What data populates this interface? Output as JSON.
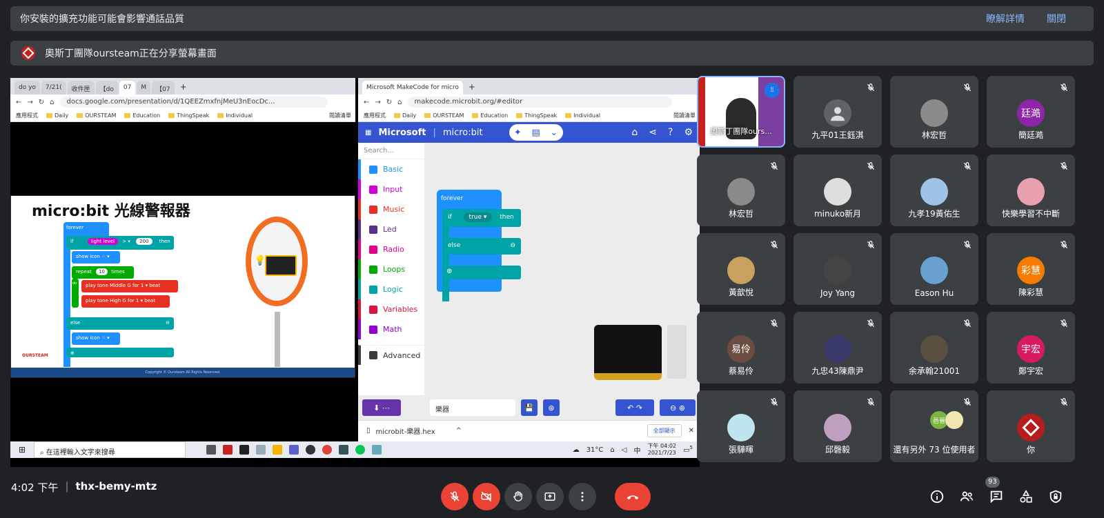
{
  "notice": {
    "text": "你安裝的擴充功能可能會影響通話品質",
    "learn_more": "瞭解詳情",
    "close": "關閉"
  },
  "share_banner": {
    "text": "奧斯丁團隊oursteam正在分享螢幕畫面"
  },
  "left_browser": {
    "tabs": [
      "do yo",
      "7/21(",
      "收件匣",
      "【do",
      "07",
      "M",
      "【07"
    ],
    "url": "docs.google.com/presentation/d/1QEEZmxfnjMeU3nEocDc...",
    "bookmarks": [
      "應用程式",
      "Daily",
      "OURSTEAM",
      "Education",
      "ThingSpeak",
      "Individual"
    ],
    "reading_list": "閱讀清單",
    "slide_title": "micro:bit 光線警報器",
    "slide_blocks": {
      "forever": "forever",
      "if": "if",
      "light_level": "light level",
      "gt": "> ▾",
      "num": "200",
      "then": "then",
      "show_icon": "show icon",
      "repeat": "repeat",
      "times_n": "10",
      "times": "times",
      "do": "do",
      "tone1": "play tone  Middle G  for  1 ▾ beat",
      "tone2": "play tone  High G  for  1 ▾ beat",
      "else": "else",
      "show_icon2": "show icon"
    },
    "slide_logo": "OURSTEAM",
    "slide_footer": "Copyright © Oursteam All Rights Reserved."
  },
  "right_browser": {
    "tab": "Microsoft MakeCode for micro",
    "url": "makecode.microbit.org/#editor",
    "bookmarks": [
      "應用程式",
      "Daily",
      "OURSTEAM",
      "Education",
      "ThingSpeak",
      "Individual"
    ],
    "reading_list": "閱讀清單",
    "brand": "Microsoft",
    "product": "micro:bit",
    "search_placeholder": "Search...",
    "categories": [
      {
        "label": "Basic",
        "color": "#1e90ff"
      },
      {
        "label": "Input",
        "color": "#d400d4"
      },
      {
        "label": "Music",
        "color": "#e63022"
      },
      {
        "label": "Led",
        "color": "#5c2d91"
      },
      {
        "label": "Radio",
        "color": "#e3008c"
      },
      {
        "label": "Loops",
        "color": "#00aa00"
      },
      {
        "label": "Logic",
        "color": "#00a4a6"
      },
      {
        "label": "Variables",
        "color": "#dc143c"
      },
      {
        "label": "Math",
        "color": "#9400d3"
      },
      {
        "label": "Advanced",
        "color": "#3c3c3c"
      }
    ],
    "blocks": {
      "forever": "forever",
      "if": "if",
      "cond": "true ▾",
      "then": "then",
      "else": "else"
    },
    "project_name": "樂器",
    "download_file": "microbit-樂器.hex",
    "show_all": "全部顯示"
  },
  "taskbar": {
    "search": "在這裡輸入文字來搜尋",
    "temp": "31°C",
    "ime": "中",
    "time": "下午 04:02",
    "date": "2021/7/23",
    "notif": "5"
  },
  "tiles": [
    {
      "name": "奧斯丁團隊ours...",
      "avatar": "",
      "avatar_color": "#ffffff",
      "presenter": true
    },
    {
      "name": "九平01王鈺淇",
      "avatar": "",
      "avatar_color": "#5f6368"
    },
    {
      "name": "林宏哲",
      "avatar": "",
      "avatar_color": "#8a8a8a"
    },
    {
      "name": "簡廷澔",
      "avatar": "廷澔",
      "avatar_color": "#8e24aa"
    },
    {
      "name": "林宏哲",
      "avatar": "",
      "avatar_color": "#8a8a8a"
    },
    {
      "name": "minuko新月",
      "avatar": "",
      "avatar_color": "#dddddd"
    },
    {
      "name": "九孝19黃佑生",
      "avatar": "",
      "avatar_color": "#9ec3e6"
    },
    {
      "name": "快樂學習不中斷",
      "avatar": "",
      "avatar_color": "#e8a0b0"
    },
    {
      "name": "黃歆悅",
      "avatar": "",
      "avatar_color": "#c8a060"
    },
    {
      "name": "Joy Yang",
      "avatar": "",
      "avatar_color": "#444444"
    },
    {
      "name": "Eason Hu",
      "avatar": "",
      "avatar_color": "#6aa0d0"
    },
    {
      "name": "陳彩慧",
      "avatar": "彩慧",
      "avatar_color": "#f57c00"
    },
    {
      "name": "蔡易伶",
      "avatar": "易伶",
      "avatar_color": "#6d4c41"
    },
    {
      "name": "九忠43陳鼎尹",
      "avatar": "",
      "avatar_color": "#3a3a6a"
    },
    {
      "name": "余承翰21001",
      "avatar": "",
      "avatar_color": "#5a5040"
    },
    {
      "name": "鄭宇宏",
      "avatar": "宇宏",
      "avatar_color": "#d81b60"
    },
    {
      "name": "張驊暉",
      "avatar": "",
      "avatar_color": "#bfe6f0"
    },
    {
      "name": "邱磬毅",
      "avatar": "",
      "avatar_color": "#c0a0c0"
    },
    {
      "name": "還有另外 73 位使用者",
      "avatar": "邑晉",
      "avatar_color": "#7cb342",
      "others": true
    },
    {
      "name": "你",
      "avatar": "",
      "avatar_color": "#b71c1c"
    }
  ],
  "bottom": {
    "time": "4:02 下午",
    "code": "thx-bemy-mtz",
    "participant_count": "93"
  },
  "colors": {
    "bg": "#202124",
    "tile": "#3c4043",
    "danger": "#ea4335",
    "link": "#8ab4f8"
  }
}
